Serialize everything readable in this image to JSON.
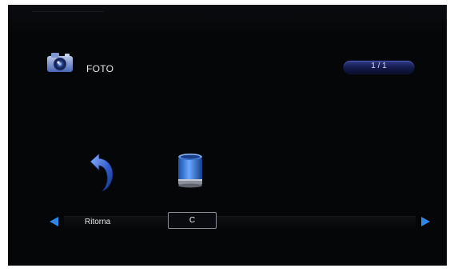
{
  "header": {
    "title": "FOTO",
    "icon": "camera-icon",
    "page_indicator": "1 / 1"
  },
  "items": [
    {
      "icon": "return-arrow-icon",
      "label": "Ritorna"
    },
    {
      "icon": "trash-bin-icon",
      "label": "C"
    }
  ],
  "nav": {
    "left_icon": "arrow-left-icon",
    "right_icon": "arrow-right-icon"
  },
  "colors": {
    "background": "#050608",
    "accent": "#2e86e6",
    "indicator": "#1c2460"
  }
}
